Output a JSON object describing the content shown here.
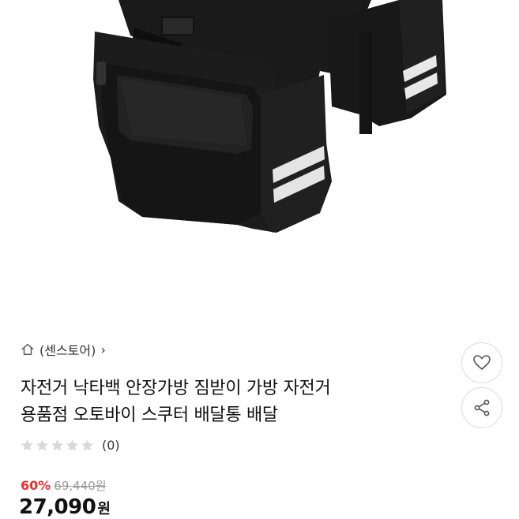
{
  "product": {
    "store_label": "(센스토어)",
    "store_chevron": "›",
    "title_lines": [
      "자전거 낙타백 안장가방 짐받이 가방 자전거",
      "용품점 오토바이 스쿠터 배달통 배달"
    ],
    "rating_stars": 0,
    "review_count": "(0)",
    "discount": "60%",
    "original_price": "69,440원",
    "price": "27,090",
    "price_unit": "원"
  },
  "icons": {
    "store": "home-icon",
    "wishlist": "heart-icon",
    "share": "share-icon",
    "star": "star-icon"
  },
  "colors": {
    "discount": "#e8322e",
    "star_empty": "#d9d9d9",
    "original_price": "#9a9a9a"
  }
}
